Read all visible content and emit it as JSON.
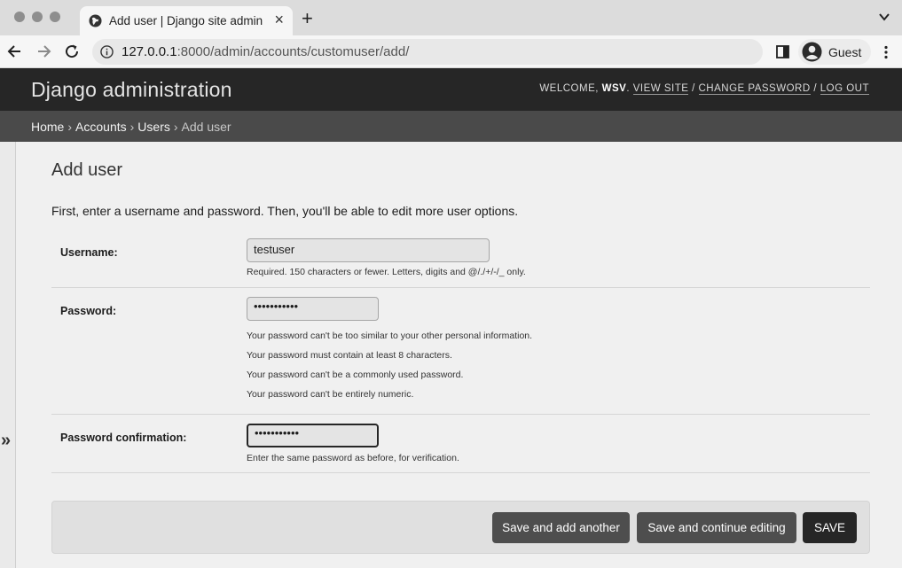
{
  "browser": {
    "tab_title": "Add user | Django site admin",
    "new_tab_label": "+",
    "url_host": "127.0.0.1",
    "url_rest": ":8000/admin/accounts/customuser/add/",
    "profile_label": "Guest"
  },
  "header": {
    "branding": "Django administration",
    "welcome": "Welcome,",
    "username": "wsv",
    "view_site": "View site",
    "change_password": "Change password",
    "log_out": "Log out"
  },
  "breadcrumbs": {
    "home": "Home",
    "app": "Accounts",
    "model": "Users",
    "current": "Add user",
    "separator": "›"
  },
  "sidebar": {
    "toggle_glyph": "»"
  },
  "page": {
    "title": "Add user",
    "intro": "First, enter a username and password. Then, you'll be able to edit more user options."
  },
  "form": {
    "username": {
      "label": "Username:",
      "value": "testuser",
      "help": "Required. 150 characters or fewer. Letters, digits and @/./+/-/_ only."
    },
    "password": {
      "label": "Password:",
      "value": "•••••••••••",
      "help": [
        "Your password can't be too similar to your other personal information.",
        "Your password must contain at least 8 characters.",
        "Your password can't be a commonly used password.",
        "Your password can't be entirely numeric."
      ]
    },
    "password_confirmation": {
      "label": "Password confirmation:",
      "value": "•••••••••••",
      "help": "Enter the same password as before, for verification."
    }
  },
  "actions": {
    "save_add_another": "Save and add another",
    "save_continue": "Save and continue editing",
    "save": "SAVE"
  }
}
